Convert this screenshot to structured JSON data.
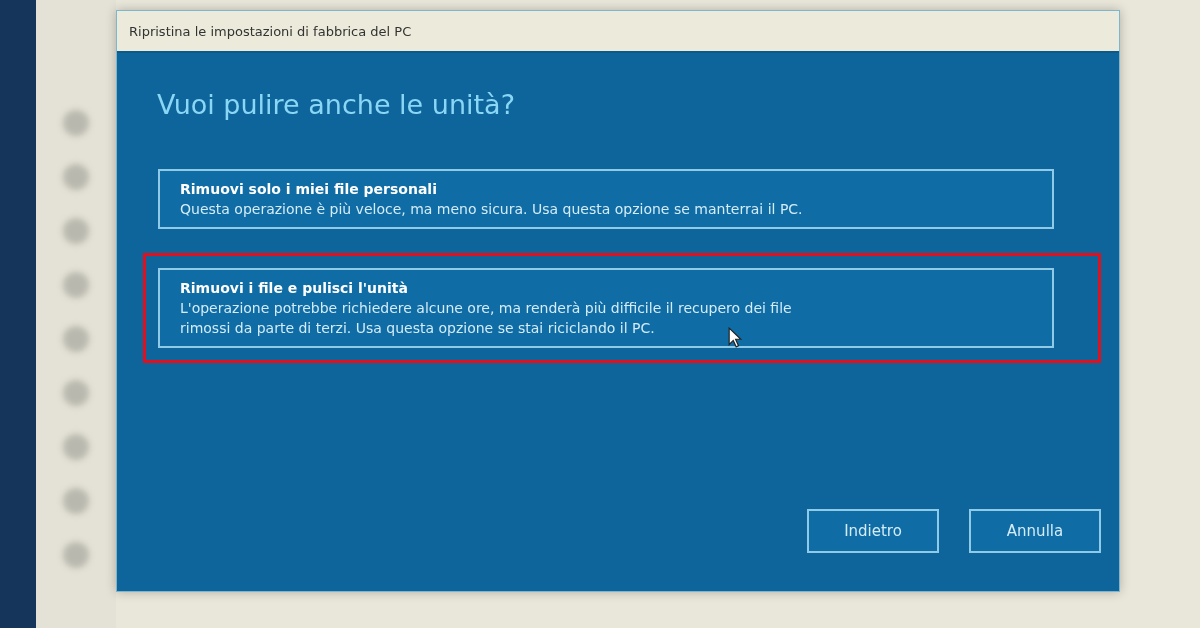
{
  "dialog": {
    "title": "Ripristina le impostazioni di fabbrica del PC",
    "heading": "Vuoi pulire anche le unità?",
    "options": [
      {
        "title": "Rimuovi solo i miei file personali",
        "lines": [
          "Questa operazione è più veloce, ma meno sicura. Usa questa opzione se manterrai il PC."
        ],
        "highlighted": false
      },
      {
        "title": "Rimuovi i file e pulisci l'unità",
        "lines": [
          "L'operazione potrebbe richiedere alcune ore, ma renderà più difficile il recupero dei file",
          "rimossi da parte di terzi. Usa questa opzione se stai riciclando il PC."
        ],
        "highlighted": true
      }
    ],
    "buttons": [
      "Indietro",
      "Annulla"
    ]
  }
}
